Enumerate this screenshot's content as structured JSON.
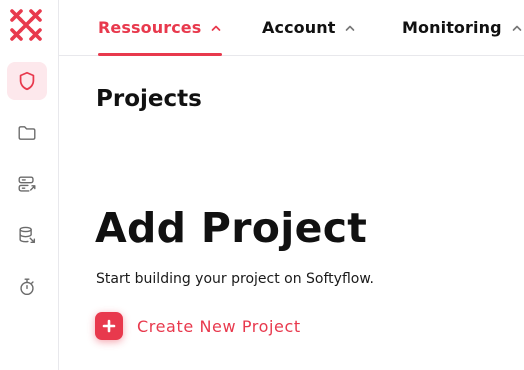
{
  "colors": {
    "accent": "#e8394d",
    "active_bg": "#fde8ec",
    "icon_gray": "#6b6b6b",
    "text": "#111111",
    "divider": "#e8e8ec"
  },
  "sidebar": {
    "logo": "x-logo",
    "items": [
      {
        "icon": "shield-icon",
        "active": true
      },
      {
        "icon": "folder-icon",
        "active": false
      },
      {
        "icon": "server-share-icon",
        "active": false
      },
      {
        "icon": "database-link-icon",
        "active": false
      },
      {
        "icon": "stopwatch-icon",
        "active": false
      }
    ]
  },
  "topnav": {
    "tabs": [
      {
        "label": "Ressources",
        "icon": "chevron-up-icon",
        "active": true
      },
      {
        "label": "Account",
        "icon": "chevron-up-icon",
        "active": false
      },
      {
        "label": "Monitoring",
        "icon": "chevron-up-icon",
        "active": false
      }
    ]
  },
  "main": {
    "page_title": "Projects",
    "hero_title": "Add Project",
    "hero_subtitle": "Start building your project on Softyflow.",
    "create_button": {
      "icon": "plus-icon",
      "label": "Create New Project"
    }
  }
}
